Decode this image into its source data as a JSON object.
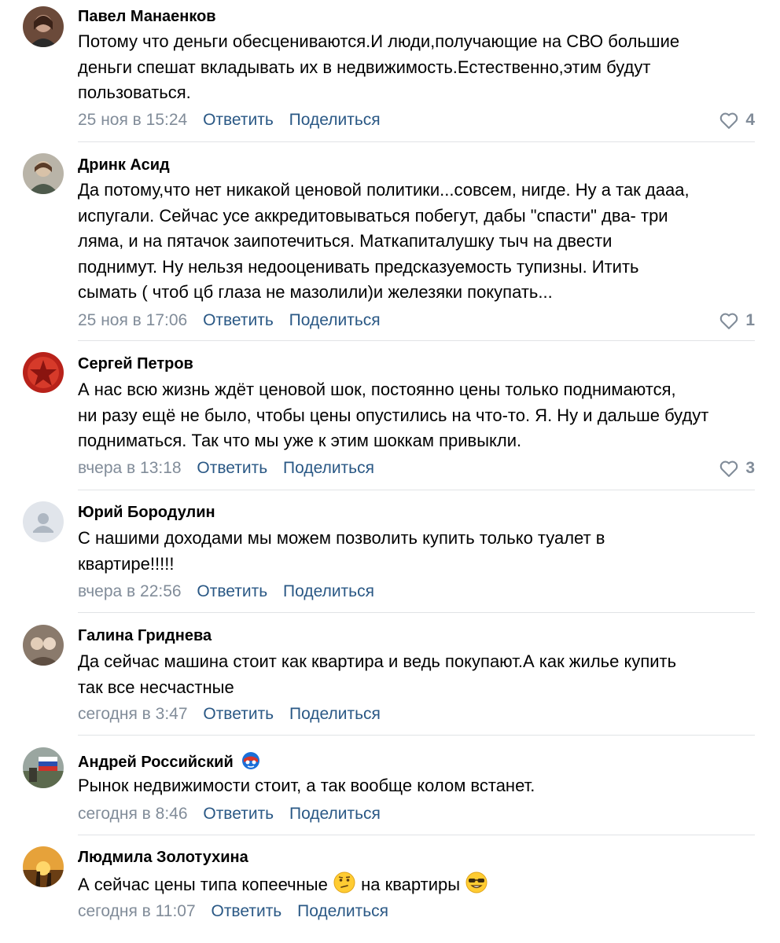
{
  "comments": [
    {
      "name": "Павел Манаенков",
      "lines": [
        "Потому что деньги обесцениваются.И люди,получающие на СВО большие",
        "деньги спешат вкладывать их в недвижимость.Естественно,этим будут",
        "пользоваться."
      ],
      "date": "25 ноя в 15:24",
      "reply": "Ответить",
      "share": "Поделиться",
      "likes": "4"
    },
    {
      "name": "Дринк Асид",
      "lines": [
        "Да потому,что нет никакой ценовой политики...совсем, нигде. Ну а так дааа,",
        "испугали. Сейчас усе аккредитовываться побегут, дабы \"спасти\" два- три",
        "ляма, и на пятачок заипотечиться. Маткапиталушку тыч на двести",
        "поднимут. Ну нельзя недооценивать предсказуемость тупизны. Итить",
        "сымать ( чтоб цб глаза не мазолили)и железяки покупать..."
      ],
      "date": "25 ноя в 17:06",
      "reply": "Ответить",
      "share": "Поделиться",
      "likes": "1"
    },
    {
      "name": "Сергей Петров",
      "lines": [
        "А нас всю жизнь ждёт ценовой шок, постоянно цены только поднимаются,",
        "ни разу ещё не было, чтобы цены опустились на что-то. Я. Ну и дальше будут",
        "подниматься. Так что мы уже к этим шоккам привыкли."
      ],
      "date": "вчера в 13:18",
      "reply": "Ответить",
      "share": "Поделиться",
      "likes": "3"
    },
    {
      "name": "Юрий Бородулин",
      "lines": [
        "С нашими доходами мы можем позволить купить только туалет в",
        "квартире!!!!!"
      ],
      "date": "вчера в 22:56",
      "reply": "Ответить",
      "share": "Поделиться",
      "likes": ""
    },
    {
      "name": "Галина Гриднева",
      "lines": [
        "Да сейчас машина стоит как квартира и ведь покупают.А как жилье купить",
        "так все несчастные"
      ],
      "date": "сегодня в 3:47",
      "reply": "Ответить",
      "share": "Поделиться",
      "likes": ""
    },
    {
      "name": "Андрей Российский",
      "lines": [
        "Рынок недвижимости стоит, а так вообще колом встанет."
      ],
      "date": "сегодня в 8:46",
      "reply": "Ответить",
      "share": "Поделиться",
      "likes": ""
    },
    {
      "name": "Людмила Золотухина",
      "text_before": "А сейчас цены типа копеечные",
      "text_middle": "на квартиры",
      "date": "сегодня в 11:07",
      "reply": "Ответить",
      "share": "Поделиться",
      "likes": ""
    }
  ],
  "icons": {
    "heart": "heart-icon",
    "badge": "superhero-badge-icon",
    "emoji_thinking": "thinking-emoji-icon",
    "emoji_cool": "sunglasses-emoji-icon"
  },
  "colors": {
    "link": "#2a5885",
    "muted": "#818c99",
    "divider": "#e1e3e6"
  }
}
